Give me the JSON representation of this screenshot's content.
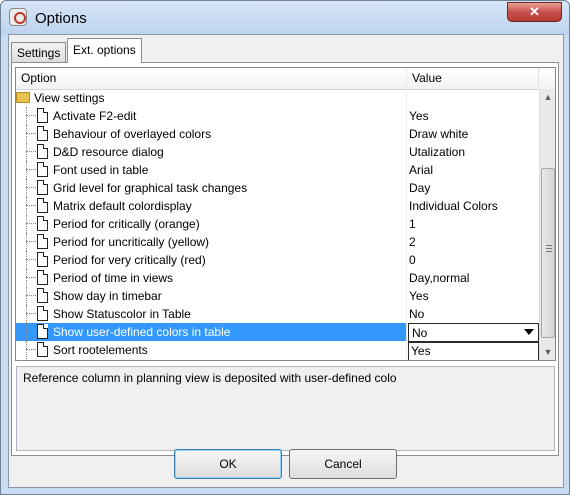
{
  "window": {
    "title": "Options",
    "close_label": "✕"
  },
  "tabs": [
    {
      "label": "Settings",
      "active": false
    },
    {
      "label": "Ext. options",
      "active": true
    }
  ],
  "table": {
    "columns": [
      "Option",
      "Value"
    ],
    "group": "View settings",
    "rows": [
      {
        "label": "Activate F2-edit",
        "value": "Yes"
      },
      {
        "label": "Behaviour of overlayed colors",
        "value": "Draw white"
      },
      {
        "label": "D&D resource dialog",
        "value": "Utalization"
      },
      {
        "label": "Font used in table",
        "value": "Arial"
      },
      {
        "label": "Grid level for graphical task changes",
        "value": "Day"
      },
      {
        "label": "Matrix default colordisplay",
        "value": "Individual Colors"
      },
      {
        "label": "Period for critically (orange)",
        "value": "1"
      },
      {
        "label": "Period for uncritically (yellow)",
        "value": "2"
      },
      {
        "label": "Period for very critically (red)",
        "value": "0"
      },
      {
        "label": "Period of time in views",
        "value": "Day,normal"
      },
      {
        "label": "Show day in timebar",
        "value": "Yes"
      },
      {
        "label": "Show Statuscolor in Table",
        "value": "No"
      },
      {
        "label": "Show user-defined colors in table",
        "value": ""
      },
      {
        "label": "Sort rootelements",
        "value": ""
      }
    ],
    "selected_index": 12
  },
  "combo": {
    "value": "No",
    "options": [
      "Yes",
      "No"
    ],
    "highlighted": "No"
  },
  "description": "Reference column in planning view is deposited with user-defined colo",
  "buttons": {
    "ok": "OK",
    "cancel": "Cancel"
  },
  "colors": {
    "selection": "#3399ff",
    "title_bar": "#c9dcf2",
    "close_button": "#c75050"
  }
}
